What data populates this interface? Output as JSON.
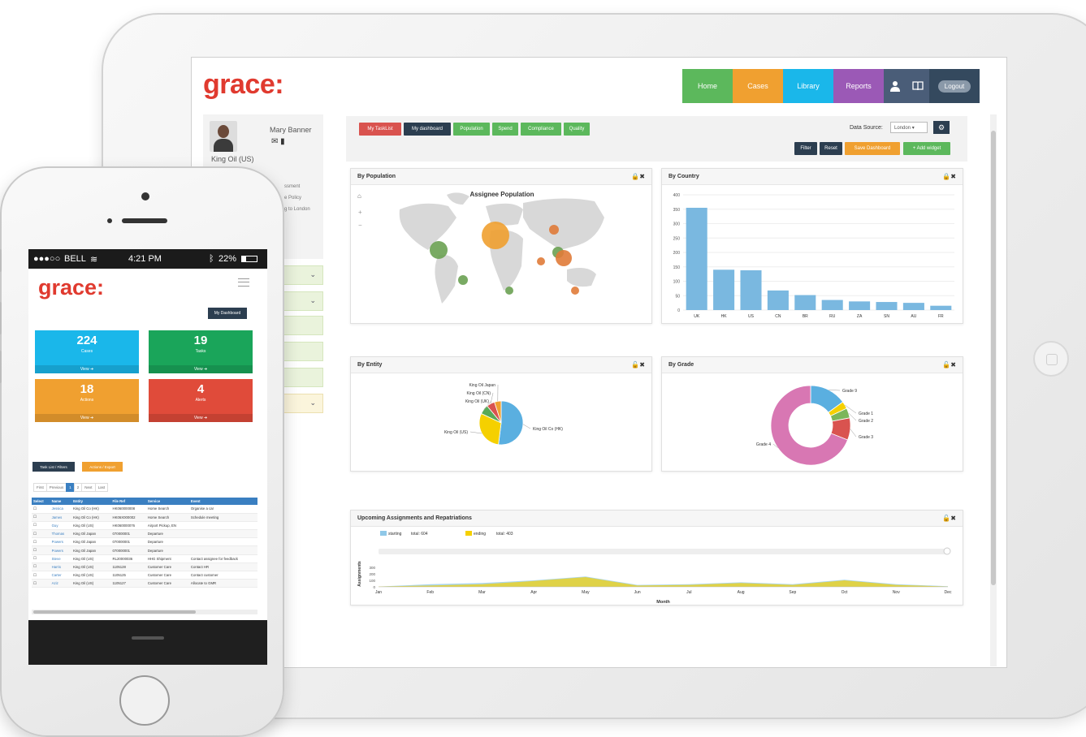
{
  "tablet": {
    "logo": "grace:",
    "nav": [
      {
        "label": "Home",
        "color": "#5cb85c"
      },
      {
        "label": "Cases",
        "color": "#f0a030"
      },
      {
        "label": "Library",
        "color": "#1ab7ea"
      },
      {
        "label": "Reports",
        "color": "#9b59b6"
      }
    ],
    "nav_logout": "Logout",
    "profile": {
      "name": "Mary Banner",
      "company": "King Oil (US)",
      "lines": [
        "ssment",
        "e Policy",
        "g to London"
      ]
    },
    "toolbar": {
      "tabs": [
        {
          "label": "My TaskList",
          "color": "#d9534f"
        },
        {
          "label": "My dashboard",
          "color": "#2c3e50"
        },
        {
          "label": "Population",
          "color": "#5cb85c"
        },
        {
          "label": "Spend",
          "color": "#5cb85c"
        },
        {
          "label": "Compliance",
          "color": "#5cb85c"
        },
        {
          "label": "Quality",
          "color": "#5cb85c"
        }
      ],
      "data_source_label": "Data Source:",
      "data_source_value": "London",
      "actions": [
        {
          "label": "Filter",
          "color": "#2c3e50"
        },
        {
          "label": "Reset",
          "color": "#2c3e50"
        },
        {
          "label": "Save Dashboard",
          "color": "#f0a030"
        },
        {
          "label": "+ Add widget",
          "color": "#5cb85c"
        }
      ]
    },
    "panels": {
      "population": {
        "title": "By Population",
        "chart_title": "Assignee Population"
      },
      "country": {
        "title": "By Country"
      },
      "entity": {
        "title": "By Entity"
      },
      "grade": {
        "title": "By Grade"
      },
      "upcoming": {
        "title": "Upcoming Assignments and Repatriations"
      }
    }
  },
  "chart_data": [
    {
      "type": "bar",
      "title": "By Country",
      "categories": [
        "UK",
        "HK",
        "US",
        "CN",
        "BR",
        "RU",
        "ZA",
        "SN",
        "AU",
        "FR"
      ],
      "values": [
        355,
        140,
        138,
        68,
        52,
        35,
        30,
        28,
        25,
        15
      ],
      "ylim": [
        0,
        400
      ],
      "yticks": [
        0,
        50,
        100,
        150,
        200,
        250,
        300,
        350,
        400
      ],
      "color": "#7ab8e0"
    },
    {
      "type": "pie",
      "title": "By Entity",
      "labels": [
        "King Oil Co (HK)",
        "King Oil (US)",
        "King Oil (UK)",
        "King Oil (CN)",
        "King Oil Japan"
      ],
      "values": [
        52,
        30,
        7,
        6,
        5
      ],
      "colors": [
        "#5aafe0",
        "#f5d000",
        "#58a957",
        "#d9534f",
        "#f0a030"
      ]
    },
    {
      "type": "pie",
      "title": "By Grade",
      "labels": [
        "Grade 9",
        "Grade 1",
        "Grade 2",
        "Grade 3",
        "Grade 4"
      ],
      "values": [
        15,
        3,
        4,
        9,
        69
      ],
      "colors": [
        "#5aafe0",
        "#f5d000",
        "#7cb65a",
        "#d9534f",
        "#d877b3"
      ],
      "donut": true
    },
    {
      "type": "area",
      "title": "Upcoming Assignments and Repatriations",
      "xlabel": "Month",
      "ylabel": "Assignments",
      "categories": [
        "Jan",
        "Feb",
        "Mar",
        "Apr",
        "May",
        "Jun",
        "Jul",
        "Aug",
        "Sep",
        "Oct",
        "Nov",
        "Dec"
      ],
      "yticks": [
        0,
        100,
        200,
        300
      ],
      "series": [
        {
          "name": "starting",
          "total": "total: 604",
          "color": "#8fc8e8",
          "values": [
            5,
            40,
            60,
            100,
            160,
            30,
            40,
            70,
            40,
            110,
            40,
            10
          ]
        },
        {
          "name": "ending",
          "total": "total: 403",
          "color": "#f5d000",
          "values": [
            5,
            20,
            40,
            90,
            150,
            20,
            30,
            60,
            30,
            100,
            30,
            5
          ]
        }
      ]
    }
  ],
  "phone": {
    "status": {
      "carrier": "BELL",
      "time": "4:21 PM",
      "battery": "22%"
    },
    "logo": "grace:",
    "dashboard_button": "My Dashboard",
    "tiles": [
      {
        "value": "224",
        "label": "Cases",
        "footer": "View",
        "color": "#1ab7ea"
      },
      {
        "value": "19",
        "label": "Tasks",
        "footer": "View",
        "color": "#1aa55a"
      },
      {
        "value": "18",
        "label": "Actions",
        "footer": "View",
        "color": "#f0a030"
      },
      {
        "value": "4",
        "label": "Alerts",
        "footer": "View",
        "color": "#e04b3a"
      }
    ],
    "buttons": [
      {
        "label": "Task List / Filters",
        "color": "#2c3e50"
      },
      {
        "label": "Actions / Export",
        "color": "#f0a030"
      }
    ],
    "pager": [
      "First",
      "Previous",
      "1",
      "2",
      "Next",
      "Last"
    ],
    "table": {
      "columns": [
        "Select",
        "Name",
        "Entity",
        "File Ref",
        "Service",
        "Event"
      ],
      "rows": [
        [
          "☐",
          "Jessica",
          "King Oil Co (HK)",
          "HK060000008",
          "Home Search",
          "Organise a car"
        ],
        [
          "☐",
          "James",
          "King Oil Co (HK)",
          "HK06X000002",
          "Home Search",
          "Schedule meeting"
        ],
        [
          "☐",
          "Guy",
          "King Oil (US)",
          "HK060000076",
          "Airport Pickup, EN",
          ""
        ],
        [
          "☐",
          "Thomas",
          "King Oil Japan",
          "070000001",
          "Departure",
          ""
        ],
        [
          "☐",
          "Powers",
          "King Oil Japan",
          "070000001",
          "Departure",
          ""
        ],
        [
          "☐",
          "Powers",
          "King Oil Japan",
          "070000001",
          "Departure",
          ""
        ],
        [
          "☐",
          "Steve",
          "King Oil (US)",
          "RL20000036",
          "HHG Shipment",
          "Contact assignee for feedback"
        ],
        [
          "☐",
          "Harris",
          "King Oil (US)",
          "1105128",
          "Customer Care",
          "Contact HR"
        ],
        [
          "☐",
          "Carter",
          "King Oil (US)",
          "1105125",
          "Customer Care",
          "Contact customer"
        ],
        [
          "☐",
          "Aziz",
          "King Oil (US)",
          "1105127",
          "Customer Care",
          "Allocate to GMR"
        ]
      ]
    }
  }
}
